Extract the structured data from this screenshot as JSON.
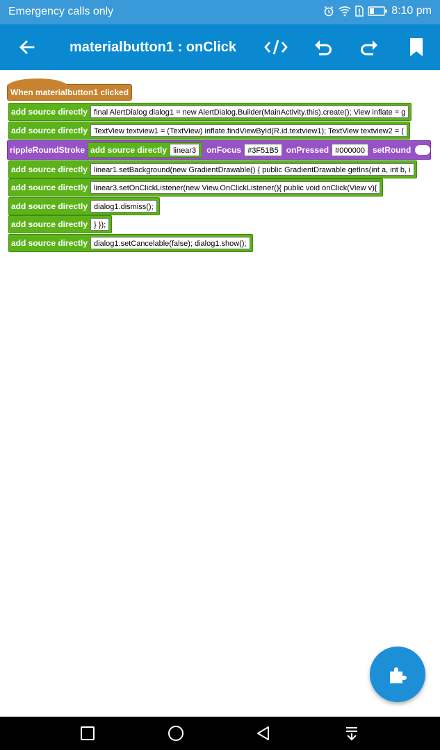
{
  "statusbar": {
    "carrier": "Emergency calls only",
    "time": "8:10 pm",
    "icons": [
      "alarm-icon",
      "wifi-icon",
      "sim-alert-icon",
      "battery-icon"
    ]
  },
  "appbar": {
    "title": "materialbutton1 : onClick",
    "icons": [
      "back-arrow-icon",
      "code-icon",
      "undo-icon",
      "redo-icon",
      "bookmark-icon"
    ]
  },
  "blocks": {
    "event_label": "When materialbutton1 clicked",
    "add_label": "add source directly",
    "rows": [
      "final AlertDialog dialog1 = new AlertDialog.Builder(MainActivity.this).create(); View inflate = g",
      "TextView textview1 = (TextView) inflate.findViewById(R.id.textview1);   TextView textview2 = (",
      "linear1.setBackground(new GradientDrawable() { public GradientDrawable getIns(int a, int b, i",
      "linear3.setOnClickListener(new View.OnClickListener(){ public void onClick(View v){",
      "dialog1.dismiss();",
      "} });",
      "dialog1.setCancelable(false); dialog1.show();"
    ],
    "ripple": {
      "label": "rippleRoundStroke",
      "inner_label": "add source directly",
      "view_value": "linear3",
      "focus_label": "onFocus",
      "focus_value": "#3F51B5",
      "pressed_label": "onPressed",
      "pressed_value": "#000000",
      "round_label": "setRound"
    }
  },
  "fab": {
    "icon": "puzzle-icon"
  },
  "navbar": {
    "icons": [
      "recent-apps-icon",
      "home-icon",
      "back-icon",
      "notification-pull-icon"
    ]
  },
  "colors": {
    "appbar": "#0a89d1",
    "statusbar": "#3a99d8",
    "event_block": "#c88330",
    "code_block": "#5cb319",
    "ripple_block": "#9852c8",
    "fab": "#1d8fd6"
  }
}
